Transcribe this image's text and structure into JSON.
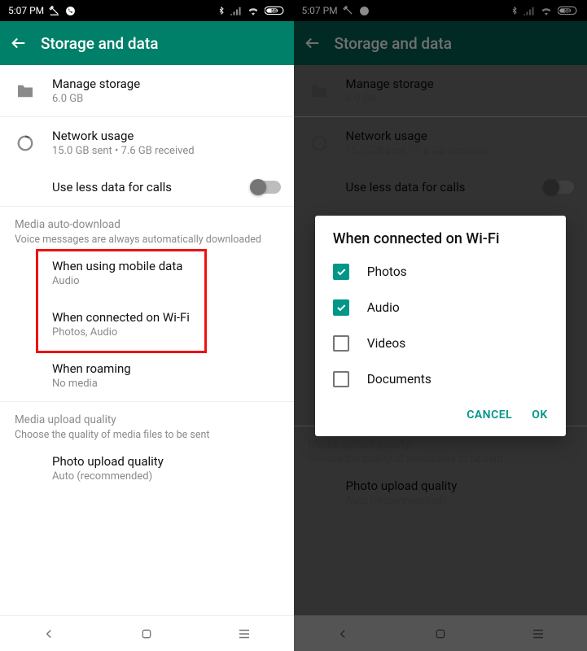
{
  "statusbar": {
    "time": "5:07 PM"
  },
  "appbar": {
    "title": "Storage and data"
  },
  "rows": {
    "manage": {
      "title": "Manage storage",
      "sub": "6.0 GB"
    },
    "network": {
      "title": "Network usage",
      "sub": "15.0 GB sent • 7.6 GB received"
    },
    "lessdata": {
      "title": "Use less data for calls"
    }
  },
  "section_media": {
    "title": "Media auto-download",
    "sub": "Voice messages are always automatically downloaded"
  },
  "media_items": {
    "mobile": {
      "title": "When using mobile data",
      "sub": "Audio"
    },
    "wifi": {
      "title": "When connected on Wi-Fi",
      "sub": "Photos, Audio"
    },
    "roaming": {
      "title": "When roaming",
      "sub": "No media"
    }
  },
  "section_upload": {
    "title": "Media upload quality",
    "sub": "Choose the quality of media files to be sent"
  },
  "upload_item": {
    "title": "Photo upload quality",
    "sub": "Auto (recommended)"
  },
  "dialog": {
    "title": "When connected on Wi-Fi",
    "options": {
      "photos": {
        "label": "Photos",
        "checked": true
      },
      "audio": {
        "label": "Audio",
        "checked": true
      },
      "videos": {
        "label": "Videos",
        "checked": false
      },
      "documents": {
        "label": "Documents",
        "checked": false
      }
    },
    "cancel": "CANCEL",
    "ok": "OK"
  }
}
